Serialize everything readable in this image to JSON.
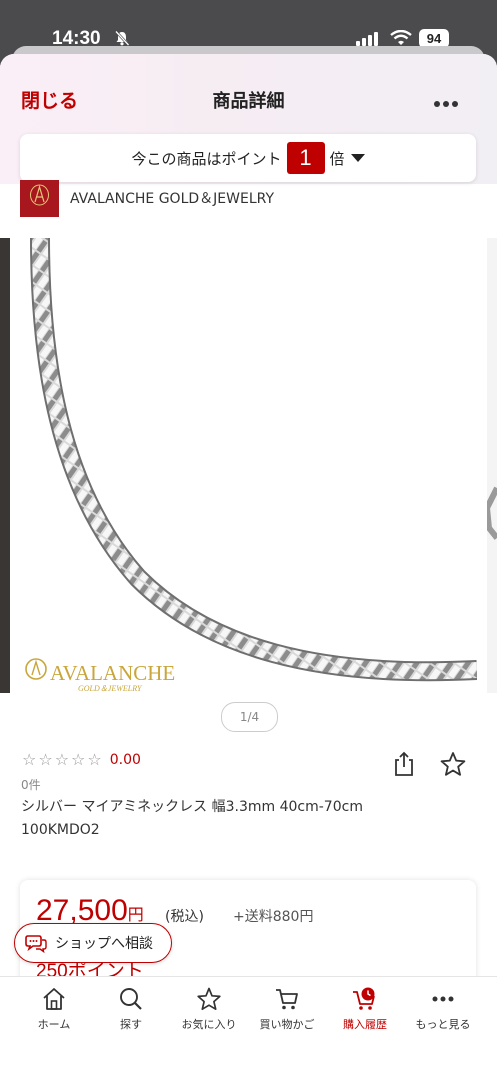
{
  "status_bar": {
    "time": "14:30",
    "battery": "94"
  },
  "header": {
    "close": "閉じる",
    "title": "商品詳細"
  },
  "points_banner": {
    "prefix": "今この商品はポイント",
    "multiplier": "1",
    "suffix": "倍"
  },
  "shop": {
    "name": "AVALANCHE GOLD＆JEWELRY",
    "logo_text": "AVALANCHE"
  },
  "gallery": {
    "brand_line1": "AVALANCHE",
    "brand_line2": "GOLD＆JEWELRY",
    "page": "1/4"
  },
  "product": {
    "stars": "☆☆☆☆☆",
    "rating": "0.00",
    "review_count": "0件",
    "title": "シルバー マイアミネックレス 幅3.3mm 40cm-70cm 100KMDO2"
  },
  "price": {
    "amount": "27,500",
    "yen": "円",
    "tax": "(税込)",
    "shipping": "+送料880円",
    "points": "250ポイント"
  },
  "consult": {
    "label": "ショップへ相談"
  },
  "tabs": [
    {
      "label": "ホーム",
      "icon": "home-icon"
    },
    {
      "label": "探す",
      "icon": "search-icon"
    },
    {
      "label": "お気に入り",
      "icon": "star-icon"
    },
    {
      "label": "買い物かご",
      "icon": "cart-icon"
    },
    {
      "label": "購入履歴",
      "icon": "purchase-history-icon"
    },
    {
      "label": "もっと見る",
      "icon": "more-icon"
    }
  ],
  "colors": {
    "accent": "#bf0000",
    "gold": "#c9a63c"
  }
}
